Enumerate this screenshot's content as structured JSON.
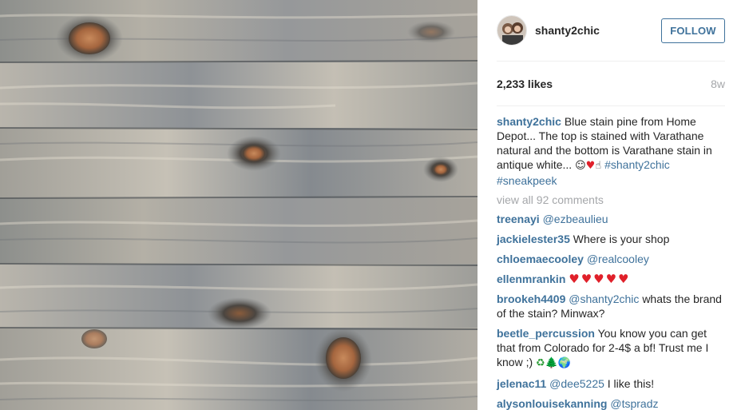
{
  "post": {
    "username": "shanty2chic",
    "follow_label": "FOLLOW",
    "likes": "2,233 likes",
    "time": "8w",
    "caption": {
      "username": "shanty2chic",
      "text": "Blue stain pine from Home Depot... The top is stained with Varathane natural and the bottom is Varathane stain in antique white...",
      "emoji": [
        "☺",
        "♥",
        "☝"
      ],
      "hashtags": [
        "#shanty2chic",
        "#sneakpeek"
      ]
    },
    "view_all": "view all 92 comments"
  },
  "comments": [
    {
      "user": "treenayi",
      "mention": "@ezbeaulieu",
      "text": ""
    },
    {
      "user": "jackielester35",
      "mention": "",
      "text": "Where is your shop"
    },
    {
      "user": "chloemaecooley",
      "mention": "@realcooley",
      "text": ""
    },
    {
      "user": "ellenmrankin",
      "mention": "",
      "text": "♥♥♥♥♥"
    },
    {
      "user": "brookeh4409",
      "mention": "@shanty2chic",
      "text": "whats the brand of the stain? Minwax?"
    },
    {
      "user": "beetle_percussion",
      "mention": "",
      "text": "You know you can get that from Colorado for 2-4$ a bf! Trust me I know ;)",
      "emoji": [
        "♻",
        "🌲",
        "🌍"
      ]
    },
    {
      "user": "jelenac11",
      "mention": "@dee5225",
      "text": "I like this!"
    },
    {
      "user": "alysonlouisekanning",
      "mention": "@tspradz",
      "text": ""
    }
  ],
  "colors": {
    "link": "#3f729b",
    "muted": "#a5a7aa",
    "wood_light": "#c9c3b9",
    "wood_dark": "#6f7478",
    "knot": "#b4724a"
  },
  "icons": {
    "image": "wood-planks-photo",
    "avatar": "profile-avatar"
  }
}
